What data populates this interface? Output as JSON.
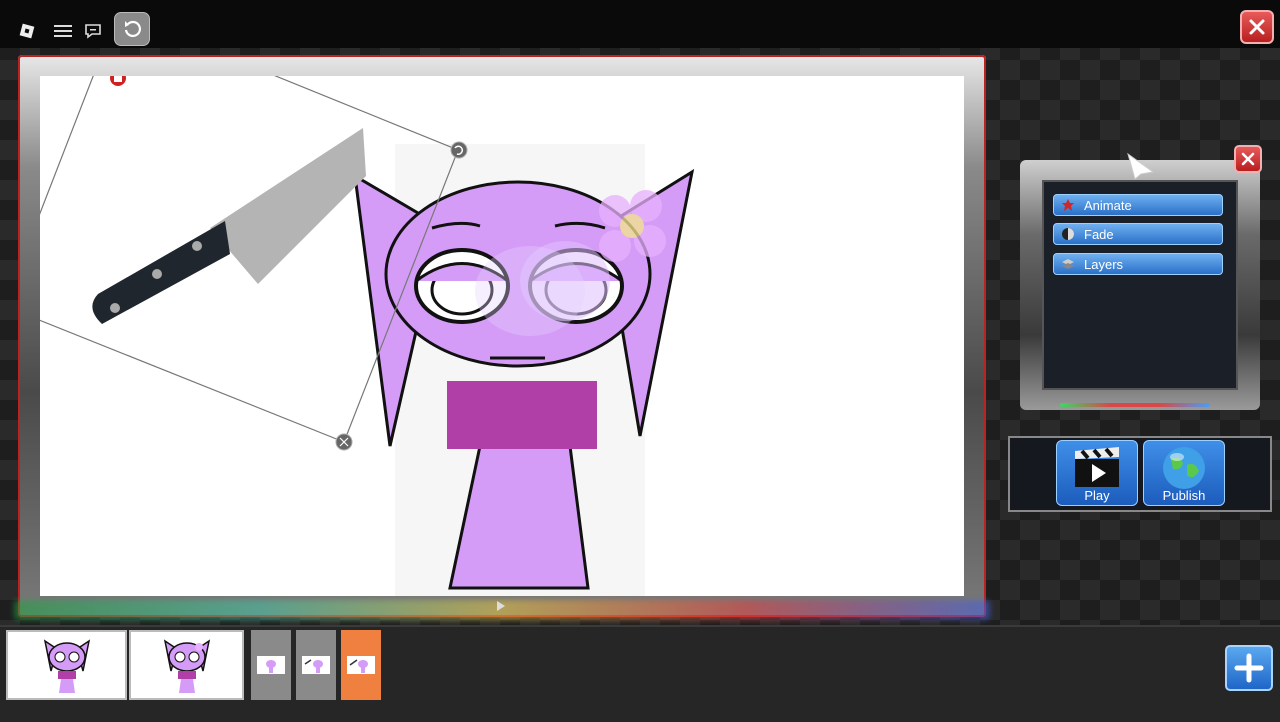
{
  "app": {
    "panel": {
      "buttons": [
        {
          "label": "Animate",
          "icon": "animate-icon"
        },
        {
          "label": "Fade",
          "icon": "fade-icon"
        },
        {
          "label": "Layers",
          "icon": "layers-icon"
        }
      ]
    },
    "actions": {
      "play_label": "Play",
      "publish_label": "Publish"
    },
    "timeline": {
      "frame_count": 5,
      "selected_frame": 5
    },
    "colors": {
      "accent_blue": "#2a70c8",
      "close_red": "#c82828",
      "selected_frame": "#f08040",
      "character_purple": "#d49cf6",
      "shirt_magenta": "#b040a8"
    }
  }
}
